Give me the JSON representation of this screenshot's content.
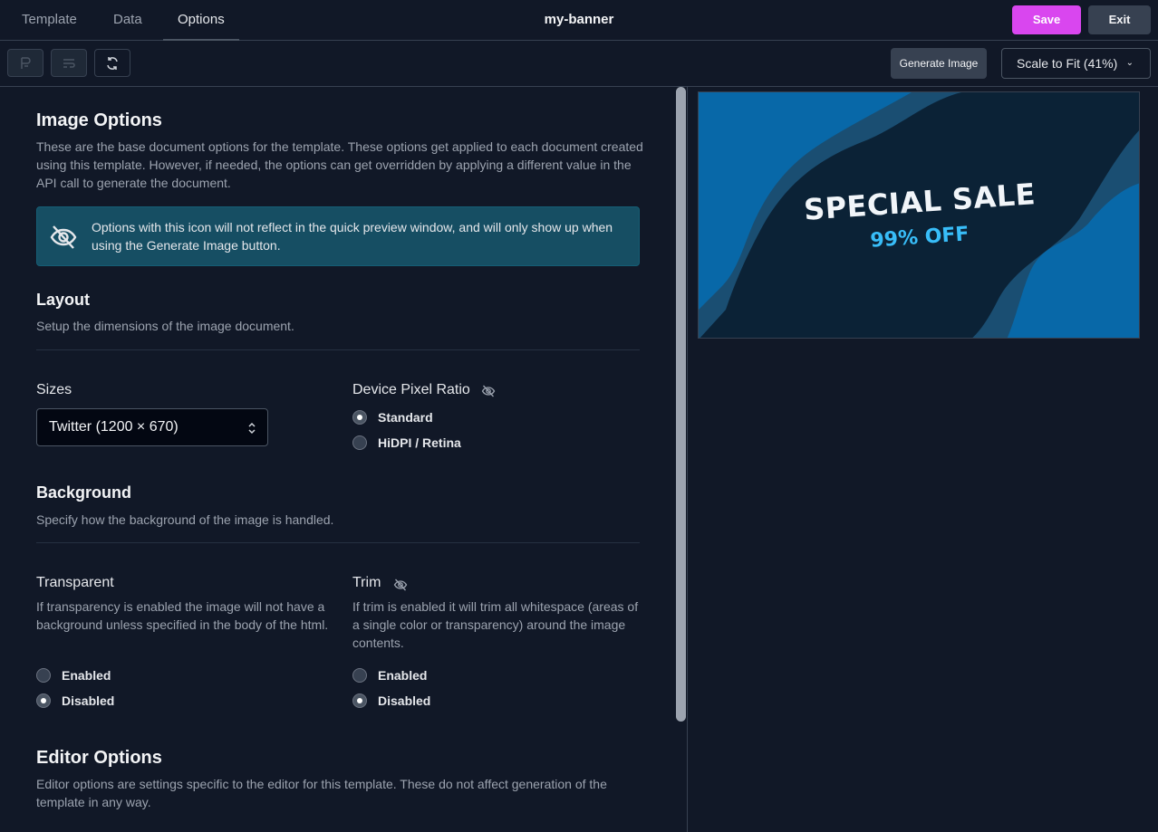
{
  "tabs": [
    {
      "label": "Template",
      "active": false
    },
    {
      "label": "Data",
      "active": false
    },
    {
      "label": "Options",
      "active": true
    }
  ],
  "document_title": "my-banner",
  "header": {
    "save_label": "Save",
    "exit_label": "Exit"
  },
  "toolbar": {
    "generate_label": "Generate Image",
    "scale_label": "Scale to Fit (41%)",
    "icons": [
      "format-icon",
      "wrap-icon",
      "refresh-icon"
    ]
  },
  "image_options": {
    "title": "Image Options",
    "description": "These are the base document options for the template. These options get applied to each document created using this template. However, if needed, the options can get overridden by applying a different value in the API call to generate the document.",
    "notice": "Options with this icon will not reflect in the quick preview window, and will only show up when using the Generate Image button."
  },
  "layout": {
    "title": "Layout",
    "description": "Setup the dimensions of the image document.",
    "sizes_label": "Sizes",
    "sizes_value": "Twitter (1200 × 670)",
    "dpr_label": "Device Pixel Ratio",
    "dpr_options": [
      {
        "label": "Standard",
        "selected": true
      },
      {
        "label": "HiDPI / Retina",
        "selected": false
      }
    ]
  },
  "background": {
    "title": "Background",
    "description": "Specify how the background of the image is handled.",
    "transparent": {
      "label": "Transparent",
      "description": "If transparency is enabled the image will not have a background unless specified in the body of the html.",
      "options": [
        {
          "label": "Enabled",
          "selected": false
        },
        {
          "label": "Disabled",
          "selected": true
        }
      ]
    },
    "trim": {
      "label": "Trim",
      "description": "If trim is enabled it will trim all whitespace (areas of a single color or transparency) around the image contents.",
      "options": [
        {
          "label": "Enabled",
          "selected": false
        },
        {
          "label": "Disabled",
          "selected": true
        }
      ]
    }
  },
  "editor_options": {
    "title": "Editor Options",
    "description": "Editor options are settings specific to the editor for this template. These do not affect generation of the template in any way."
  },
  "preview": {
    "headline": "SPECIAL SALE",
    "subline": "99% OFF"
  },
  "colors": {
    "save": "#d946ef",
    "notice_bg": "#164e63",
    "banner_accent": "#38bdf8"
  }
}
